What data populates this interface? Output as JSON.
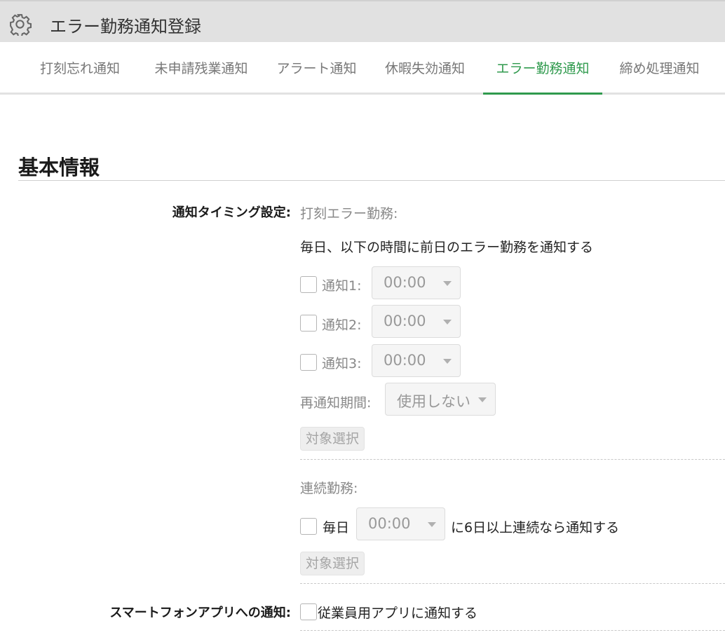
{
  "header": {
    "title": "エラー勤務通知登録",
    "icon": "gear-icon"
  },
  "tabs": [
    {
      "label": "打刻忘れ通知"
    },
    {
      "label": "未申請残業通知"
    },
    {
      "label": "アラート通知"
    },
    {
      "label": "休暇失効通知"
    },
    {
      "label": "エラー勤務通知",
      "active": true
    },
    {
      "label": "締め処理通知"
    }
  ],
  "accent_color": "#2f9a4d",
  "section": {
    "title": "基本情報"
  },
  "timing": {
    "label": "通知タイミング設定:",
    "error_heading": "打刻エラー勤務:",
    "description": "毎日、以下の時間に前日のエラー勤務を通知する",
    "notifications": [
      {
        "label": "通知1:",
        "value": "00:00",
        "checked": false
      },
      {
        "label": "通知2:",
        "value": "00:00",
        "checked": false
      },
      {
        "label": "通知3:",
        "value": "00:00",
        "checked": false
      }
    ],
    "renotify": {
      "label": "再通知期間:",
      "value": "使用しない"
    },
    "target_button": "対象選択",
    "consecutive": {
      "heading": "連続勤務:",
      "daily_label": "毎日",
      "time_value": "00:00",
      "suffix": "に6日以上連続なら通知する",
      "target_button": "対象選択"
    }
  },
  "smartphone": {
    "label": "スマートフォンアプリへの通知:",
    "option": "従業員用アプリに通知する",
    "checked": false
  }
}
